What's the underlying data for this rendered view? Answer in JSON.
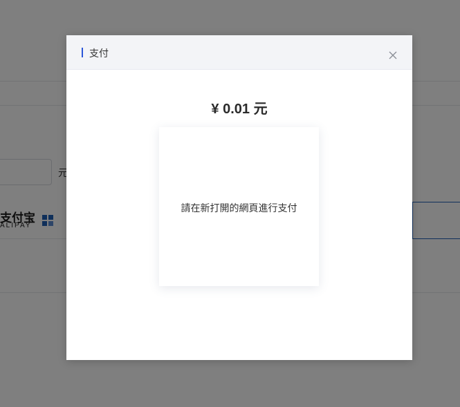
{
  "background": {
    "unit_label": "元",
    "alipay": {
      "cn_label": "支付宝",
      "en_label": "ALIPAY",
      "icon": "alipay-logo-icon"
    }
  },
  "modal": {
    "title": "支付",
    "close_icon": "close-icon",
    "amount": "¥ 0.01 元",
    "message": "請在新打開的網頁進行支付",
    "accent_color": "#2a56d8"
  }
}
